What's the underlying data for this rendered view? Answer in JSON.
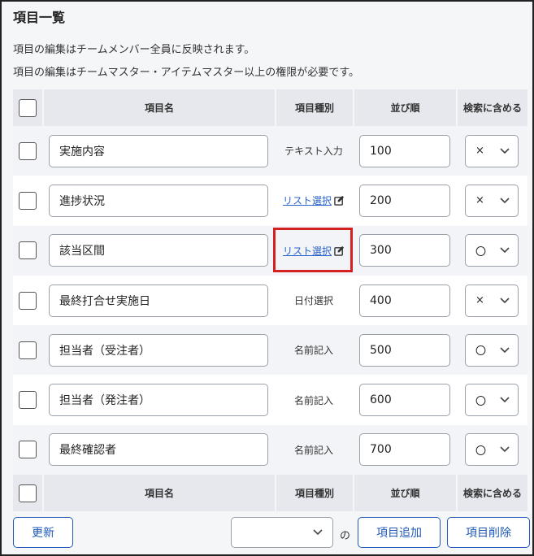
{
  "page": {
    "title": "項目一覧",
    "description_1": "項目の編集はチームメンバー全員に反映されます。",
    "description_2": "項目の編集はチームマスター・アイテムマスター以上の権限が必要です。"
  },
  "columns": {
    "name": "項目名",
    "type": "項目種別",
    "order": "並び順",
    "search": "検索に含める"
  },
  "rows": [
    {
      "name": "実施内容",
      "type": "テキスト入力",
      "type_link": false,
      "order": "100",
      "search": "×"
    },
    {
      "name": "進捗状況",
      "type": "リスト選択",
      "type_link": true,
      "order": "200",
      "search": "×"
    },
    {
      "name": "該当区間",
      "type": "リスト選択",
      "type_link": true,
      "order": "300",
      "search": "〇"
    },
    {
      "name": "最終打合せ実施日",
      "type": "日付選択",
      "type_link": false,
      "order": "400",
      "search": "×"
    },
    {
      "name": "担当者（受注者）",
      "type": "名前記入",
      "type_link": false,
      "order": "500",
      "search": "〇"
    },
    {
      "name": "担当者（発注者）",
      "type": "名前記入",
      "type_link": false,
      "order": "600",
      "search": "〇"
    },
    {
      "name": "最終確認者",
      "type": "名前記入",
      "type_link": false,
      "order": "700",
      "search": "〇"
    }
  ],
  "footer": {
    "update_label": "更新",
    "no_label": "の",
    "add_label": "項目追加",
    "delete_label": "項目削除",
    "select_value": ""
  },
  "colors": {
    "link": "#2a62c9",
    "button": "#1f58b8",
    "highlight": "#d32020"
  }
}
